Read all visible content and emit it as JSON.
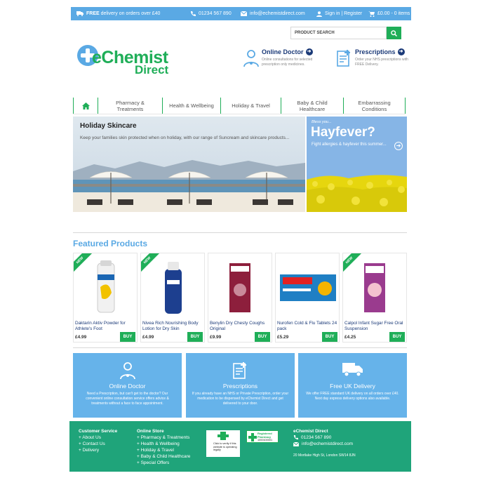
{
  "topbar": {
    "delivery_bold": "FREE",
    "delivery_rest": "delivery on orders over £40",
    "phone": "01234 567 890",
    "email": "info@echemistdirect.com",
    "signin": "Sign in | Register",
    "basket": "£0.00 - 0 items"
  },
  "search": {
    "placeholder": "PRODUCT SEARCH"
  },
  "logo": {
    "line1": "eChemist",
    "line2": "Direct"
  },
  "promos": [
    {
      "title": "Online Doctor",
      "desc": "Online consultations for selected prescription only medicines."
    },
    {
      "title": "Prescriptions",
      "desc": "Order your NHS prescriptions with FREE Delivery."
    }
  ],
  "nav": {
    "items": [
      {
        "label": "Pharmacy &\nTreatments"
      },
      {
        "label": "Health & Wellbeing"
      },
      {
        "label": "Holiday & Travel"
      },
      {
        "label": "Baby & Child\nHealthcare"
      },
      {
        "label": "Embarrassing\nConditions"
      }
    ]
  },
  "hero": {
    "title": "Holiday Skincare",
    "text": "Keep your families skin protected when on holiday, with our range of Suncream and skincare products..."
  },
  "side_banner": {
    "kicker": "Bless you...",
    "title": "Hayfever?",
    "text": "Fight allergies & hayfever this summer..."
  },
  "featured": {
    "heading": "Featured Products",
    "new_label": "NEW",
    "buy_label": "BUY",
    "products": [
      {
        "name": "Daktarin Aktiv Powder for Athlete's Foot",
        "price": "£4.99",
        "is_new": true
      },
      {
        "name": "Nivea Rich Nourishing Body Lotion for Dry Skin",
        "price": "£4.99",
        "is_new": true
      },
      {
        "name": "Benylin Dry Chesty Coughs Original",
        "price": "£9.99",
        "is_new": false
      },
      {
        "name": "Nurofen Cold & Flu Tablets 24 pack",
        "price": "£5.29",
        "is_new": false
      },
      {
        "name": "Calpol Infant Sugar Free Oral Suspension",
        "price": "£4.25",
        "is_new": true
      }
    ]
  },
  "info_boxes": [
    {
      "title": "Online Doctor",
      "text": "Need a Prescription, but can't get to the doctor? Our convenient online consultation service offers advice & treatments without a face to face appointment."
    },
    {
      "title": "Prescriptions",
      "text": "If you already have an NHS or Private Prescription, order your medication to be dispensed by eChemist Direct and get delivered to your door."
    },
    {
      "title": "Free UK Delivery",
      "text": "We offer FREE standard UK delivery on all orders over £40. Next day express delivery options also available."
    }
  ],
  "footer": {
    "customer_service": {
      "heading": "Customer Service",
      "links": [
        "+ About Us",
        "+ Contact Us",
        "+ Delivery"
      ]
    },
    "online_store": {
      "heading": "Online Store",
      "links": [
        "+ Pharmacy & Treatments",
        "+ Health & Wellbeing",
        "+ Holiday & Travel",
        "+ Baby & Child Healthcare",
        "+ Special Offers"
      ]
    },
    "company": {
      "heading": "eChemist Direct",
      "phone": "01234 567 890",
      "email": "info@echemistdirect.com",
      "address": "20 Mortlake High St, London SW14 8JN"
    },
    "badge1": "Click to verify if this website is operating legally",
    "badge2_title": "Registered Pharmacy",
    "badge2_num": "1000100001"
  },
  "colors": {
    "green": "#1fae58",
    "blue": "#5aa9e4",
    "navy": "#1b3a78",
    "footer": "#1fa47a"
  }
}
